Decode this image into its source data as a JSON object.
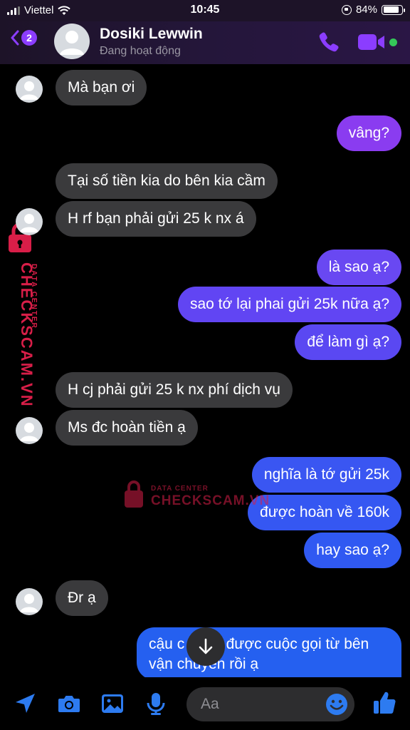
{
  "status_bar": {
    "carrier": "Viettel",
    "time": "10:45",
    "battery": "84%"
  },
  "header": {
    "back_badge": "2",
    "name": "Dosiki Lewwin",
    "status": "Đang hoạt động"
  },
  "messages": [
    {
      "side": "in",
      "text": "Mà bạn ơi"
    },
    {
      "side": "out",
      "text": "vâng?"
    },
    {
      "side": "in",
      "text": "Tại số tiền kia do bên kia cầm"
    },
    {
      "side": "in",
      "text": "H rf bạn phải gửi 25 k nx á"
    },
    {
      "side": "out",
      "text": "là sao ạ?"
    },
    {
      "side": "out",
      "text": "sao tớ lại phai gửi 25k nữa ạ?"
    },
    {
      "side": "out",
      "text": "để làm gì ạ?"
    },
    {
      "side": "in",
      "text": "H cj phải gửi 25 k nx phí dịch vụ"
    },
    {
      "side": "in",
      "text": "Ms đc hoàn tiền ạ"
    },
    {
      "side": "out",
      "text": "nghĩa là tớ gửi 25k"
    },
    {
      "side": "out",
      "text": "được hoàn về 160k"
    },
    {
      "side": "out",
      "text": "hay sao ạ?"
    },
    {
      "side": "in",
      "text": "Đr ạ"
    },
    {
      "side": "out",
      "text": "cậu c nhận được cuộc gọi từ bên vận chuyển rồi ạ"
    }
  ],
  "composer": {
    "placeholder": "Aa"
  },
  "watermark": {
    "brand": "CHECKSCAM.VN",
    "sub": "DATA CENTER"
  },
  "colors": {
    "incoming": "#3a3a3c",
    "outgoing_top": "#8a3cf0",
    "outgoing_bottom": "#1f5cf0",
    "accent": "#8b3dff",
    "online": "#35c759",
    "icon_blue": "#2d7bf0",
    "watermark": "#d81e48"
  }
}
